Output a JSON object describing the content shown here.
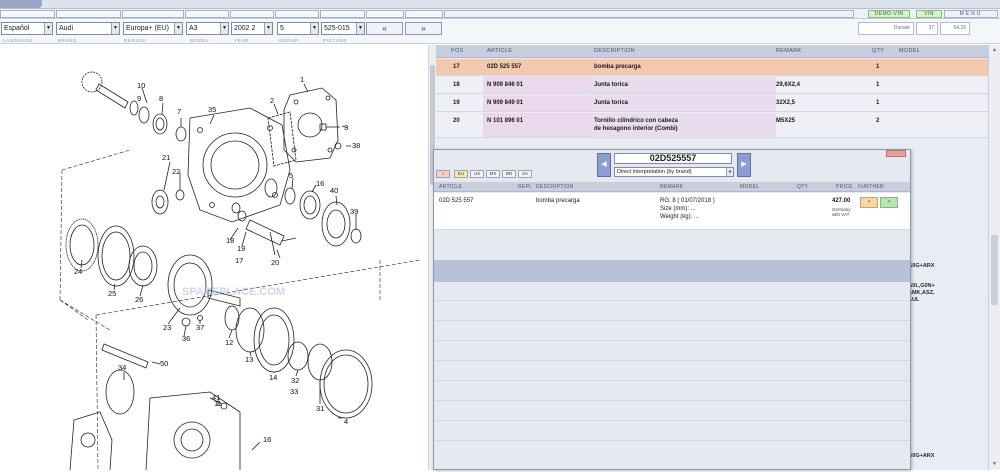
{
  "toolbar": {
    "demo_vin_label": "DEMO-VIN",
    "vin_label": "VIN",
    "menu_label": "MENU"
  },
  "selectors": {
    "language": "Español",
    "brand": "Audi",
    "region": "Europa+ (EU)",
    "model": "A3",
    "year": "2002",
    "year_sub": "2",
    "group": "5",
    "picture": "525-015",
    "prev_label": "«",
    "next_label": "»",
    "donate_label": "Donate",
    "counter_a": "37",
    "counter_b": "64.26"
  },
  "labels": {
    "language": "LANGUAGE",
    "brand": "BRAND",
    "region": "REGION",
    "model": "MODEL",
    "year": "YEAR",
    "group": "GROUP",
    "picture": "PICTURE"
  },
  "diagram": {
    "watermark": "SPAREPLACE.COM",
    "callouts": [
      "1",
      "2",
      "3",
      "4",
      "5",
      "7",
      "8",
      "9",
      "10",
      "11",
      "12",
      "13",
      "14",
      "16",
      "17",
      "18",
      "19",
      "20",
      "21",
      "22",
      "23",
      "24",
      "25",
      "26",
      "31",
      "32",
      "33",
      "34",
      "35",
      "36",
      "37",
      "38",
      "39",
      "40",
      "41",
      "50"
    ]
  },
  "list": {
    "headers": {
      "pos": "POS",
      "article": "ARTICLE",
      "description": "DESCRIPTION",
      "remark": "REMARK",
      "qty": "QTY",
      "model": "MODEL"
    },
    "rows": [
      {
        "pos": "17",
        "article": "02D 525 557",
        "description": "bomba precarga",
        "description2": "",
        "remark": "",
        "qty": "1"
      },
      {
        "pos": "18",
        "article": "N   909 846 01",
        "description": "Junta torica",
        "description2": "",
        "remark": "29,6X2,4",
        "qty": "1"
      },
      {
        "pos": "19",
        "article": "N   909 849 01",
        "description": "Junta torica",
        "description2": "",
        "remark": "32X2,5",
        "qty": "1"
      },
      {
        "pos": "20",
        "article": "N   101 896 01",
        "description": "Tornillo cilindrico con cabeza",
        "description2": "de hexagono interior (Combi)",
        "remark": "M5X25",
        "qty": "2"
      }
    ],
    "edge_text_1": "G0G+ARX",
    "edge_text_2a": "G0L,G0N+",
    "edge_text_2b": "AMK,ASZ,",
    "edge_text_2c": "AUL",
    "edge_text_3": "G0G+ARX"
  },
  "popup": {
    "part_number": "02D525557",
    "interpretation": "Direct interpretation (by brand)",
    "flags": [
      "»",
      "EU",
      "US",
      "MX",
      "BR",
      "SA"
    ],
    "headers": {
      "article": "ARTICLE",
      "repl": "REPL",
      "description": "DESCRIPTION",
      "remark": "REMARK",
      "model": "MODEL",
      "qty": "QTY",
      "price": "PRICE",
      "further": "FURTHER"
    },
    "row": {
      "article": "02D 525 557",
      "description": "bomba precarga",
      "remark_1": "RG: 8 ( 01/07/2018 )",
      "remark_2": "Size (mm): ...",
      "remark_3": "Weight (kg): ...",
      "price": "427.00",
      "price_note_1": "Germany",
      "price_note_2": "with VAT",
      "btn_1": ">",
      "btn_2": ">"
    }
  }
}
